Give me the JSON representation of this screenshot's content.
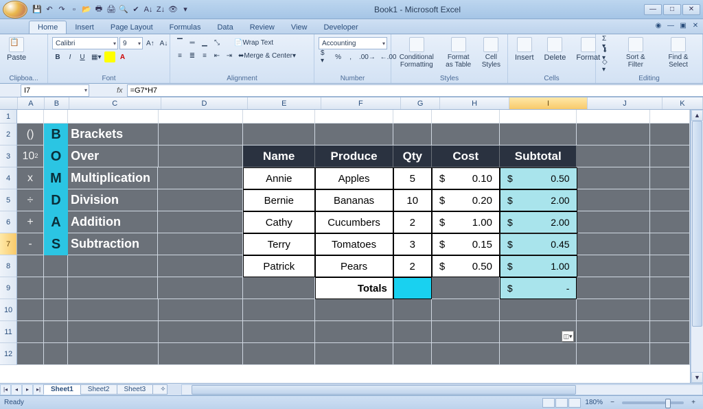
{
  "window": {
    "title": "Book1 - Microsoft Excel"
  },
  "tabs": [
    "Home",
    "Insert",
    "Page Layout",
    "Formulas",
    "Data",
    "Review",
    "View",
    "Developer"
  ],
  "active_tab": "Home",
  "ribbon": {
    "clipboard": {
      "label": "Clipboa...",
      "paste": "Paste"
    },
    "font": {
      "label": "Font",
      "name": "Calibri",
      "size": "9"
    },
    "alignment": {
      "label": "Alignment",
      "wrap": "Wrap Text",
      "merge": "Merge & Center"
    },
    "number": {
      "label": "Number",
      "format": "Accounting"
    },
    "styles": {
      "label": "Styles",
      "cond": "Conditional Formatting",
      "table": "Format as Table",
      "cell": "Cell Styles"
    },
    "cells": {
      "label": "Cells",
      "insert": "Insert",
      "delete": "Delete",
      "format": "Format"
    },
    "editing": {
      "label": "Editing",
      "sort": "Sort & Filter",
      "find": "Find & Select"
    }
  },
  "namebox": "I7",
  "formula": "=G7*H7",
  "columns": [
    "A",
    "B",
    "C",
    "D",
    "E",
    "F",
    "G",
    "H",
    "I",
    "J",
    "K"
  ],
  "active_col": "I",
  "active_row": 7,
  "bomdas": [
    {
      "sym": "()",
      "letter": "B",
      "word": "Brackets"
    },
    {
      "sym": "10",
      "sup": "2",
      "letter": "O",
      "word": "Over"
    },
    {
      "sym": "x",
      "letter": "M",
      "word": "Multiplication"
    },
    {
      "sym": "÷",
      "letter": "D",
      "word": "Division"
    },
    {
      "sym": "+",
      "letter": "A",
      "word": "Addition"
    },
    {
      "sym": "-",
      "letter": "S",
      "word": "Subtraction"
    }
  ],
  "table": {
    "headers": [
      "Name",
      "Produce",
      "Qty",
      "Cost",
      "Subtotal"
    ],
    "rows": [
      {
        "name": "Annie",
        "produce": "Apples",
        "qty": "5",
        "cost": "0.10",
        "subtotal": "0.50"
      },
      {
        "name": "Bernie",
        "produce": "Bananas",
        "qty": "10",
        "cost": "0.20",
        "subtotal": "2.00"
      },
      {
        "name": "Cathy",
        "produce": "Cucumbers",
        "qty": "2",
        "cost": "1.00",
        "subtotal": "2.00"
      },
      {
        "name": "Terry",
        "produce": "Tomatoes",
        "qty": "3",
        "cost": "0.15",
        "subtotal": "0.45"
      },
      {
        "name": "Patrick",
        "produce": "Pears",
        "qty": "2",
        "cost": "0.50",
        "subtotal": "1.00"
      }
    ],
    "totals_label": "Totals",
    "totals_subtotal": "-",
    "currency": "$"
  },
  "sheets": [
    "Sheet1",
    "Sheet2",
    "Sheet3"
  ],
  "active_sheet": "Sheet1",
  "status": {
    "text": "Ready",
    "zoom": "180%"
  }
}
